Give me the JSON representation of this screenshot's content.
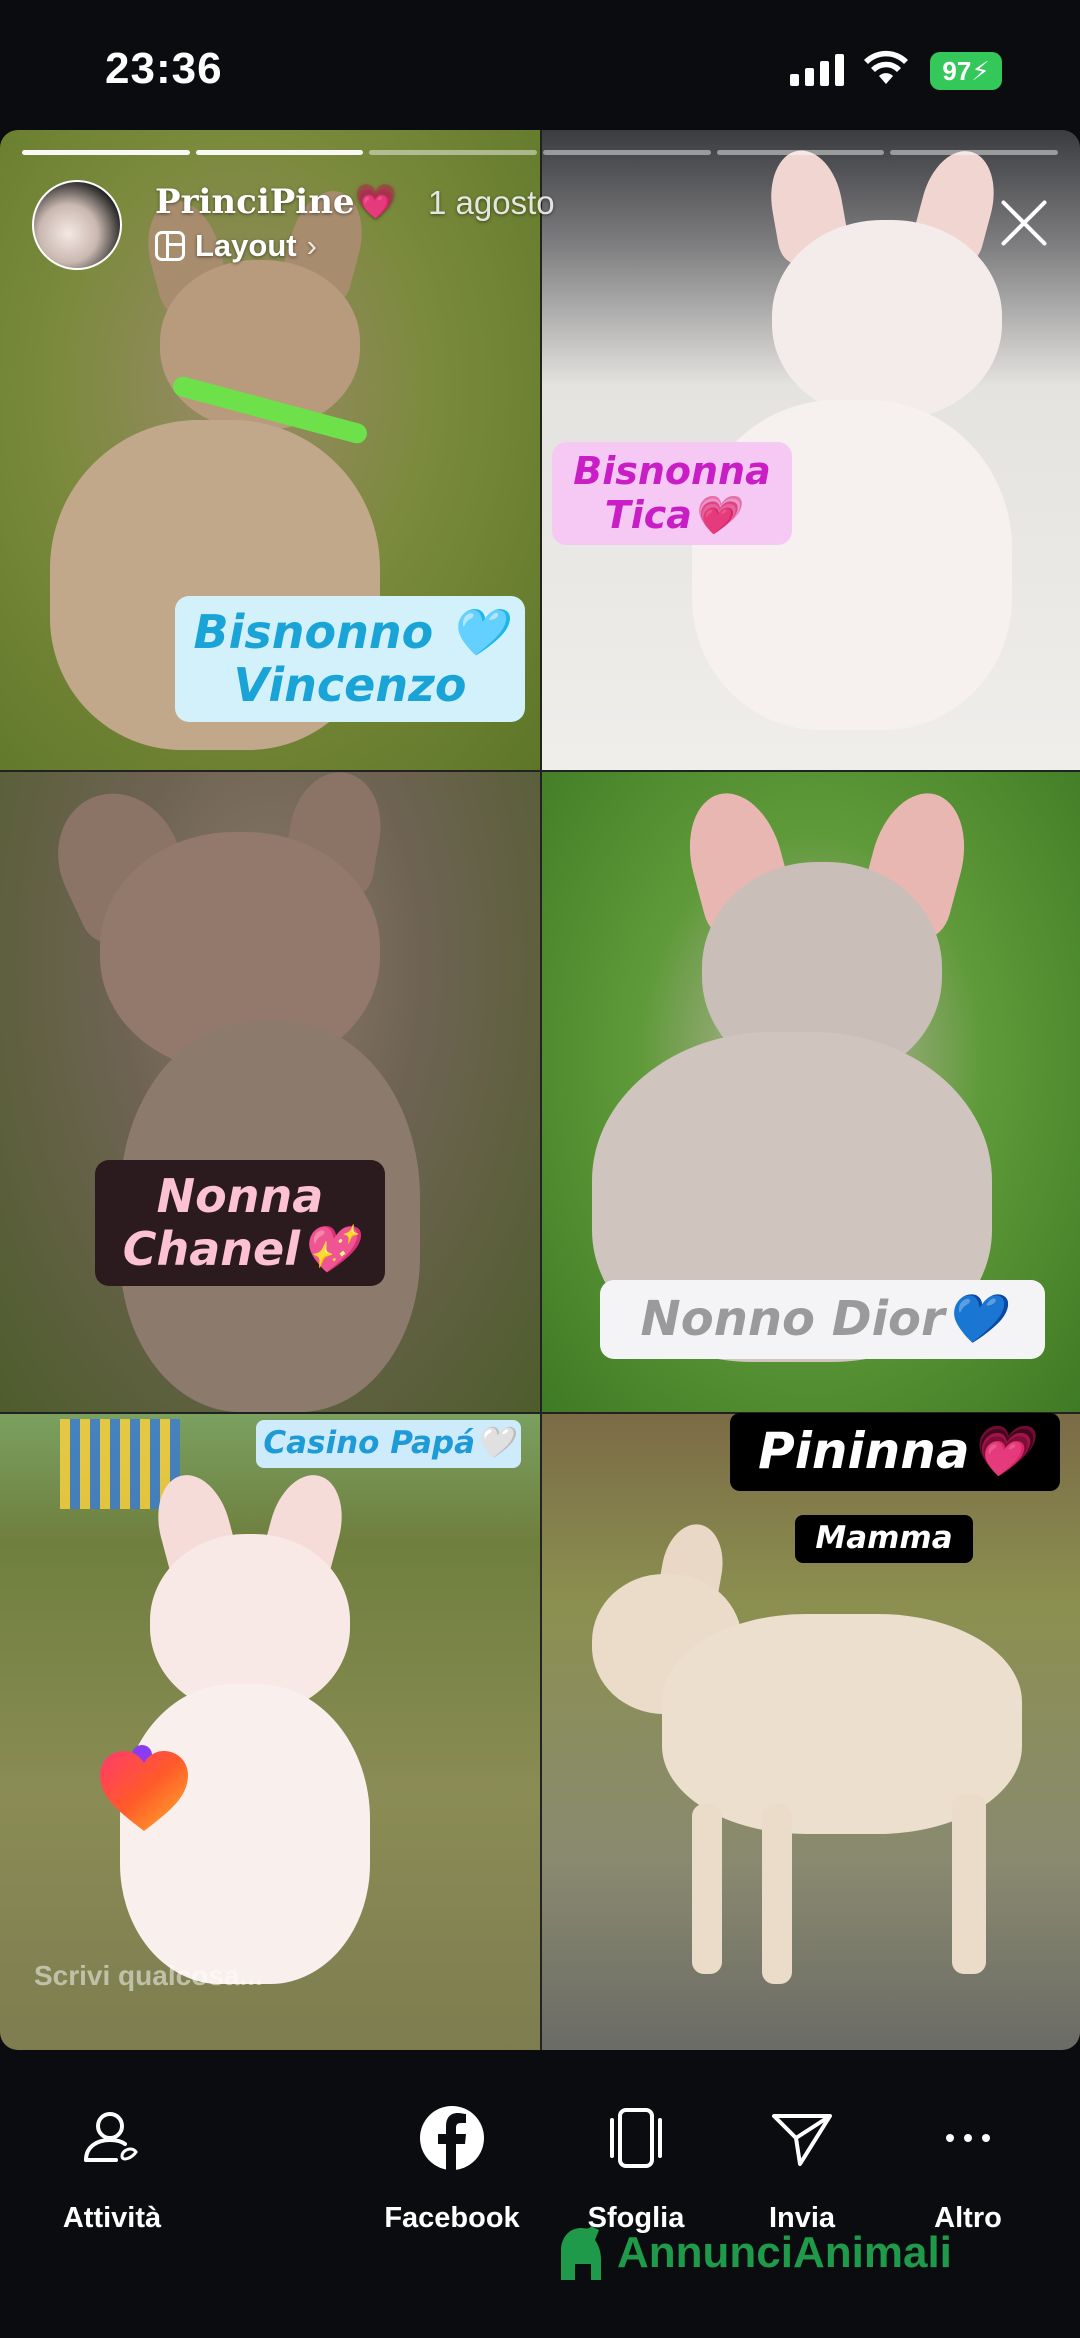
{
  "status": {
    "time": "23:36",
    "battery": "97"
  },
  "story": {
    "username": "PrinciPine💗",
    "date": "1 agosto",
    "layout_label": "Layout",
    "layout_chevron": "›",
    "progress_total": 6,
    "progress_done": 2,
    "stickers": {
      "bisnonno": "Bisnonno 🩵 Vincenzo",
      "bisnonna": "Bisnonna Tica💗",
      "nonna": "Nonna Chanel💖",
      "nonno": "Nonno Dior💙",
      "papa": "Casino Papá🤍",
      "pininna": "Pininna💗",
      "mamma": "Mamma"
    },
    "reply_placeholder": "Scrivi qualcosa..."
  },
  "toolbar": {
    "activity": "Attività",
    "facebook": "Facebook",
    "browse": "Sfoglia",
    "send": "Invia",
    "more": "Altro"
  },
  "watermark": "AnnunciAnimali",
  "colors": {
    "battery": "#34c759",
    "watermark": "#1f9a4a"
  }
}
